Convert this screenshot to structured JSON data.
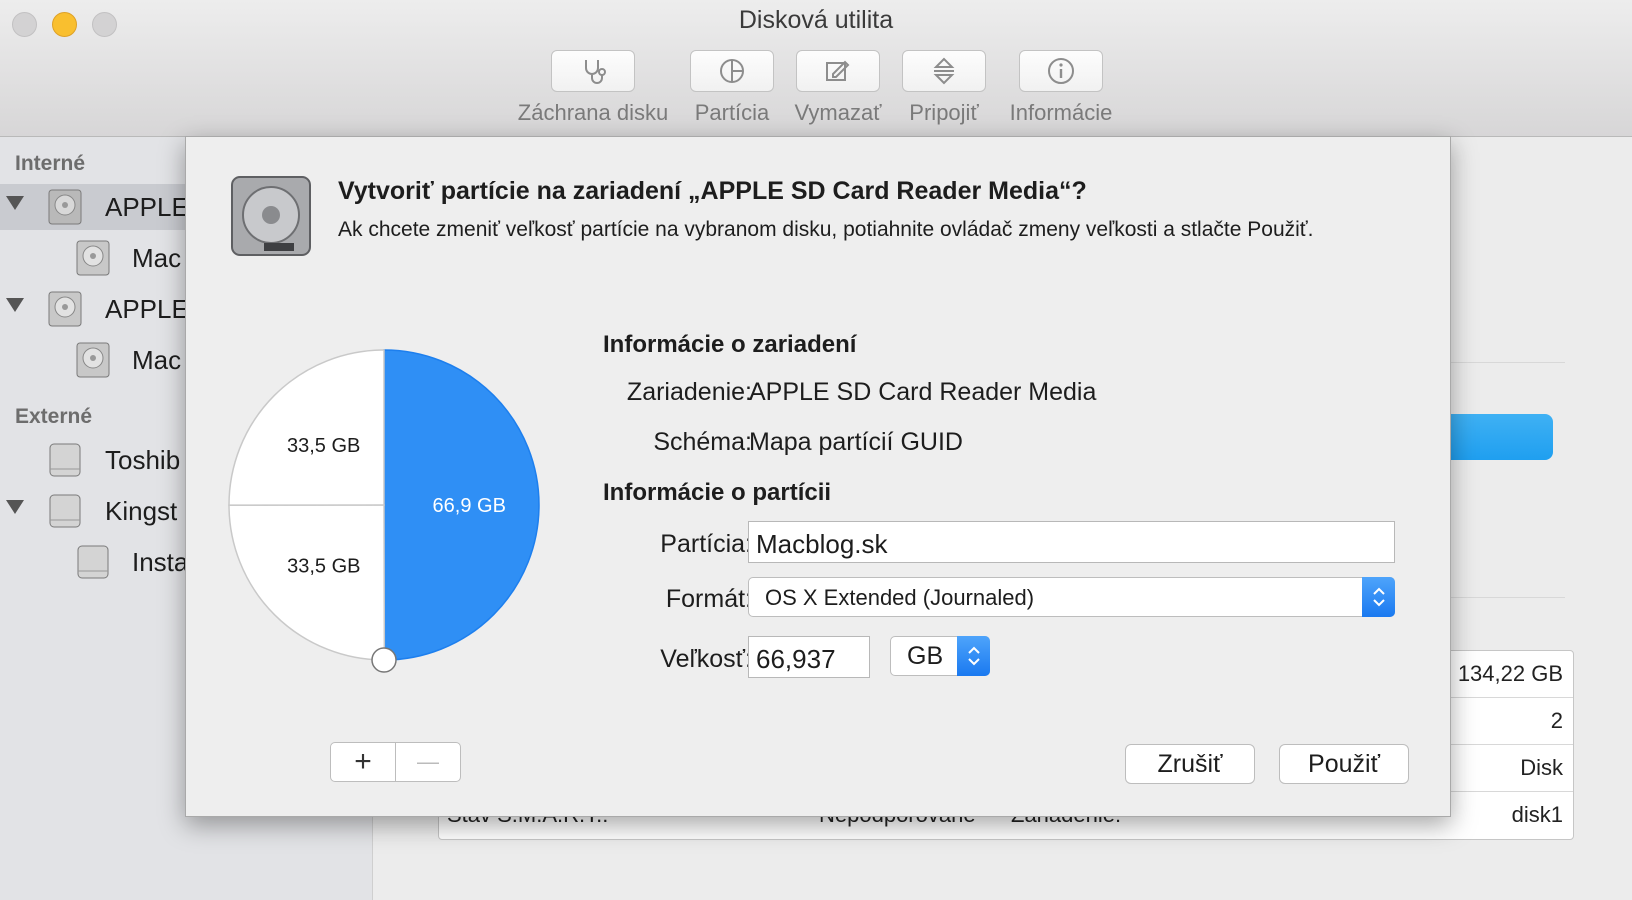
{
  "window": {
    "title": "Disková utilita"
  },
  "toolbar": {
    "buttons": [
      {
        "label": "Záchrana disku",
        "icon": "stethoscope-icon"
      },
      {
        "label": "Partícia",
        "icon": "pie-chart-icon"
      },
      {
        "label": "Vymazať",
        "icon": "eraser-icon"
      },
      {
        "label": "Pripojiť",
        "icon": "mount-icon"
      },
      {
        "label": "Informácie",
        "icon": "info-icon"
      }
    ]
  },
  "sidebar": {
    "sections": [
      "Interné",
      "Externé"
    ],
    "items": [
      {
        "label": "APPLE",
        "icon": "internal-disk-icon"
      },
      {
        "label": "Mac",
        "icon": "volume-icon"
      },
      {
        "label": "APPLE",
        "icon": "internal-disk-icon"
      },
      {
        "label": "Mac",
        "icon": "volume-icon"
      },
      {
        "label": "Toshib",
        "icon": "external-disk-icon"
      },
      {
        "label": "Kingst",
        "icon": "external-disk-icon"
      },
      {
        "label": "Insta",
        "icon": "external-volume-icon"
      }
    ]
  },
  "background_info": {
    "values": [
      "134,22 GB",
      "2",
      "Disk",
      "disk1"
    ],
    "bottom_row": {
      "label1": "Stav S.M.A.R.T.:",
      "value1": "Nepodporované",
      "label2": "Zariadenie:"
    }
  },
  "sheet": {
    "heading": "Vytvoriť partície na zariadení „APPLE SD Card Reader Media“?",
    "description": "Ak chcete zmeniť veľkosť partície na vybranom disku, potiahnite ovládač zmeny veľkosti a stlačte Použiť.",
    "pie": {
      "partitions": [
        {
          "label": "66,9 GB",
          "size_gb": 66.9,
          "selected": true
        },
        {
          "label": "33,5 GB",
          "size_gb": 33.5,
          "selected": false
        },
        {
          "label": "33,5 GB",
          "size_gb": 33.5,
          "selected": false
        }
      ]
    },
    "device_info": {
      "title": "Informácie o zariadení",
      "device_label": "Zariadenie:",
      "device_value": "APPLE SD Card Reader Media",
      "scheme_label": "Schéma:",
      "scheme_value": "Mapa partícií GUID"
    },
    "partition_info": {
      "title": "Informácie o partícii",
      "name_label": "Partícia:",
      "name_value": "Macblog.sk",
      "format_label": "Formát:",
      "format_value": "OS X Extended (Journaled)",
      "size_label": "Veľkosť:",
      "size_value": "66,937",
      "unit_value": "GB"
    },
    "buttons": {
      "add": "+",
      "remove": "—",
      "cancel": "Zrušiť",
      "apply": "Použiť"
    }
  },
  "colors": {
    "accent": "#1a79f0",
    "pie_fill": "#2f8ff5",
    "selection": "#c9cbd0"
  }
}
